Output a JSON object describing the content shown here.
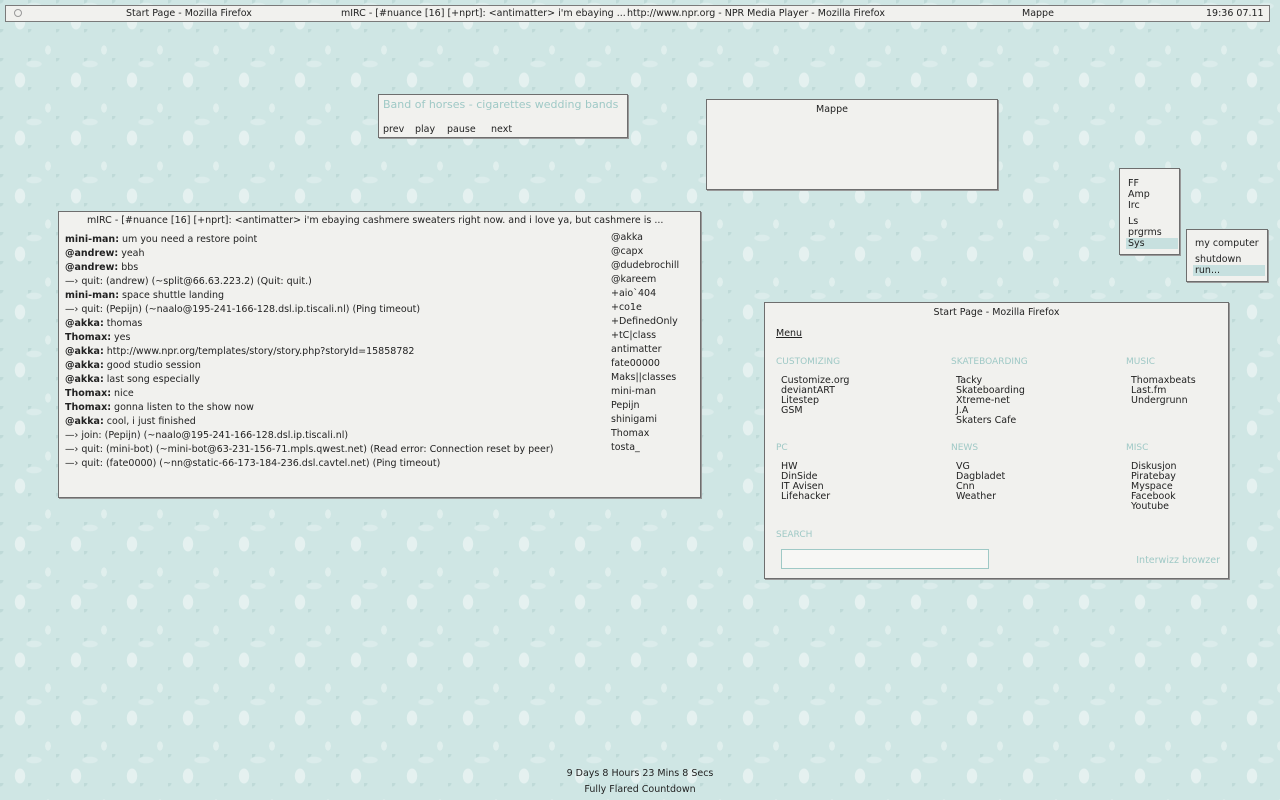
{
  "topbar": {
    "window1": "Start Page - Mozilla Firefox",
    "window2": "mIRC - [#nuance [16] [+nprt]: <antimatter> i'm ebaying ...",
    "window3": "http://www.npr.org - NPR Media Player - Mozilla Firefox",
    "window4": "Mappe",
    "clock": "19:36  07.11"
  },
  "music": {
    "song": "Band of horses - cigarettes wedding bands",
    "prev": "prev",
    "play": "play",
    "pause": "pause",
    "next": "next"
  },
  "mappe": {
    "title": "Mappe"
  },
  "launcher": {
    "items": [
      "FF",
      "Amp",
      "Irc",
      "Ls",
      "prgrms",
      "Sys"
    ]
  },
  "sysmenu": {
    "items": [
      "my computer",
      "shutdown",
      "run..."
    ]
  },
  "mirc": {
    "title": "mIRC - [#nuance [16] [+nprt]: <antimatter> i'm ebaying cashmere sweaters right now. and i love ya, but cashmere is ...",
    "lines": [
      {
        "nick": "mini-man:",
        "text": " um you need a restore point"
      },
      {
        "nick": "@andrew:",
        "text": " yeah"
      },
      {
        "nick": "@andrew:",
        "text": " bbs"
      },
      {
        "nick": "",
        "text": "   —› quit: (andrew) (~split@66.63.223.2) (Quit: quit.)"
      },
      {
        "nick": "mini-man:",
        "text": " space shuttle landing"
      },
      {
        "nick": "",
        "text": "   —› quit: (Pepijn) (~naalo@195-241-166-128.dsl.ip.tiscali.nl) (Ping timeout)"
      },
      {
        "nick": "@akka:",
        "text": " thomas"
      },
      {
        "nick": "Thomax:",
        "text": " yes"
      },
      {
        "nick": "@akka:",
        "text": " http://www.npr.org/templates/story/story.php?storyId=15858782"
      },
      {
        "nick": "@akka:",
        "text": " good studio session"
      },
      {
        "nick": "@akka:",
        "text": " last song especially"
      },
      {
        "nick": "Thomax:",
        "text": " nice"
      },
      {
        "nick": "Thomax:",
        "text": " gonna listen to the show now"
      },
      {
        "nick": "@akka:",
        "text": " cool, i just finished"
      },
      {
        "nick": "",
        "text": "   —› join: (Pepijn) (~naalo@195-241-166-128.dsl.ip.tiscali.nl)"
      },
      {
        "nick": "",
        "text": "   —› quit: (mini-bot) (~mini-bot@63-231-156-71.mpls.qwest.net) (Read error: Connection reset by peer)"
      },
      {
        "nick": "",
        "text": "   —› quit: (fate0000) (~nn@static-66-173-184-236.dsl.cavtel.net) (Ping timeout)"
      }
    ],
    "users": [
      "@akka",
      "@capx",
      "@dudebrochill",
      "@kareem",
      "+aio`404",
      "+co1e",
      "+DefinedOnly",
      "+tC|class",
      "antimatter",
      "fate00000",
      "Maks||classes",
      "mini-man",
      "Pepijn",
      "shinigami",
      "Thomax",
      "tosta_"
    ]
  },
  "startpage": {
    "title": "Start Page - Mozilla Firefox",
    "menu": "Menu",
    "sections": [
      {
        "heading": "CUSTOMIZING",
        "links": [
          "Customize.org",
          "deviantART",
          "Litestep",
          "GSM"
        ]
      },
      {
        "heading": "SKATEBOARDING",
        "links": [
          "Tacky",
          "Skateboarding",
          "Xtreme-net",
          "J.A",
          "Skaters Cafe"
        ]
      },
      {
        "heading": "MUSIC",
        "links": [
          "Thomaxbeats",
          "Last.fm",
          "Undergrunn"
        ]
      },
      {
        "heading": "PC",
        "links": [
          "HW",
          "DinSide",
          "IT Avisen",
          "Lifehacker"
        ]
      },
      {
        "heading": "NEWS",
        "links": [
          "VG",
          "Dagbladet",
          "Cnn",
          "Weather"
        ]
      },
      {
        "heading": "MISC",
        "links": [
          "Diskusjon",
          "Piratebay",
          "Myspace",
          "Facebook",
          "Youtube"
        ]
      }
    ],
    "search_heading": "SEARCH",
    "search_value": "",
    "brand": "Interwizz browzer"
  },
  "countdown": {
    "time": "9 Days 8 Hours 23 Mins 8 Secs",
    "label": "Fully Flared Countdown"
  }
}
